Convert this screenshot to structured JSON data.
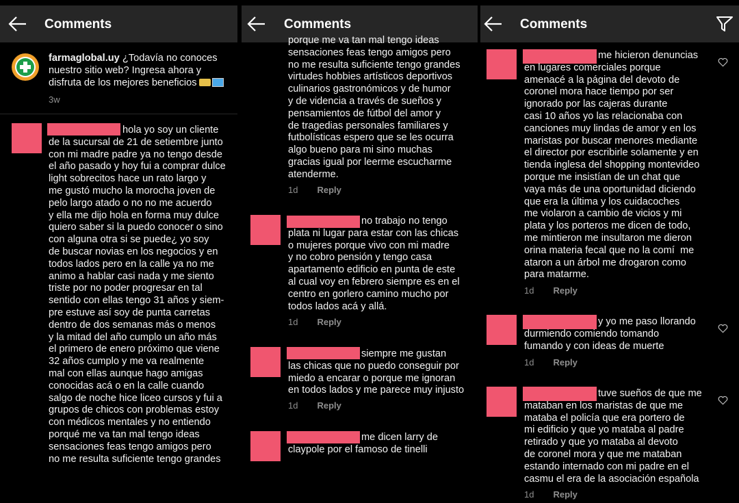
{
  "header": {
    "title": "Comments"
  },
  "panel1": {
    "caption": {
      "username": "farmaglobal.uy",
      "text_line1": " ¿Todavía no conoces",
      "lines": "nuestro sitio web? Ingresa ahora y\ndisfruta de los mejores beneficios",
      "time": "3w"
    },
    "comment": {
      "text": "hola yo soy un cliente\nde la sucursal de 21 de setiembre junto\ncon mi madre padre ya no tengo desde\nel año pasado y hoy fui a comprar dulce\nlight sobrecitos hace un rato largo y\nme gustó mucho la morocha joven de\npelo largo atado o no no me acuerdo\ny ella me dijo hola en forma muy dulce\nquiero saber si la puedo conocer o sino\ncon alguna otra si se puede¿ yo soy\nde buscar novias en los negocios y en\ntodos lados pero en la calle ya no me\nanimo a hablar casi nada y me siento\ntriste por no poder progresar en tal\nsentido con ellas tengo 31 años y siem-\npre estuve así soy de punta carretas\ndentro de dos semanas más o menos\ny la mitad del año cumplo un año más\nel primero de enero próximo que viene\n32 años cumplo y me va realmente\nmal con ellas aunque hago amigas\nconocidas acá o en la calle cuando\nsalgo de noche hice liceo cursos y fui a\ngrupos de chicos con problemas estoy\ncon médicos mentales y no entiendo\nporqué me va tan mal tengo ideas\nsensaciones feas tengo amigos pero\nno me resulta suficiente tengo grandes"
    }
  },
  "panel2": {
    "c1": {
      "text": "porque me va tan mal tengo ideas\nsensaciones feas tengo amigos pero\nno me resulta suficiente tengo grandes\nvirtudes hobbies artísticos deportivos\nculinarios gastronómicos y de humor\ny de videncia a través de sueños y\npensamientos de fútbol del amor y\nde tragedias personales familiares y\nfutbolísticas espero que se les ocurra\nalgo bueno para mi sino muchas\ngracias igual por leerme escucharme\natenderme.",
      "time": "1d",
      "reply": "Reply"
    },
    "c2": {
      "text": "no trabajo no tengo\nplata ni lugar para estar con las chicas\no mujeres porque vivo con mi madre\ny no cobro pensión y tengo casa\napartamento edificio en punta de este\nal cual voy en febrero siempre es en el\ncentro en gorlero camino mucho por\ntodos lados acá y allá.",
      "time": "1d",
      "reply": "Reply"
    },
    "c3": {
      "text": "siempre me gustan\nlas chicas que no puedo conseguir por\nmiedo a encarar o porque me ignoran\nen todos lados y me parece muy injusto",
      "time": "1d",
      "reply": "Reply"
    },
    "c4": {
      "text": "me dicen larry de\nclaypole por el famoso de tinelli"
    }
  },
  "panel3": {
    "c1": {
      "text": "me hicieron denuncias\nen lugares comerciales porque\namenacé a la página del devoto de\ncoronel mora hace tiempo por ser\nignorado por las cajeras durante\ncasi 10 años yo las relacionaba con\ncanciones muy lindas de amor y en los\nmaristas por buscar menores mediante\nel director por escribirle solamente y en\ntienda inglesa del shopping montevideo\nporque me insistían de un chat que\nvaya más de una oportunidad diciendo\nque era la última y los cuidacoches\nme violaron a cambio de vicios y mi\nplata y los porteros me dicen de todo,\nme mintieron me insultaron me dieron\norina materia fecal que no la comí  me\nataron a un árbol me drogaron como\npara matarme.",
      "time": "1d",
      "reply": "Reply"
    },
    "c2": {
      "text": "y yo me paso llorando\ndurmiendo comiendo tomando\nfumando y con ideas de muerte",
      "time": "1d",
      "reply": "Reply"
    },
    "c3": {
      "text": "tuve sueños de que me\nmataban en los maristas de que me\nmataba el policía que era portero de\nmi edificio y que yo mataba al padre\nretirado y que yo mataba al devoto\nde coronel mora y que me mataban\nestando internado con mi padre en el\ncasmu el era de la asociación española",
      "time": "1d",
      "reply": "Reply"
    }
  }
}
